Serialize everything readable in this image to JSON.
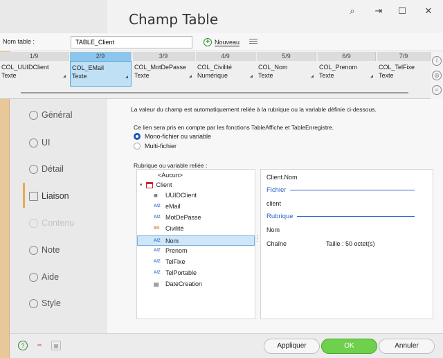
{
  "window": {
    "title": "Champ Table"
  },
  "titlebar_icons": [
    "search-icon",
    "pin-icon",
    "maximize-icon",
    "close-icon"
  ],
  "titlebar_glyphs": {
    "search": "⌕",
    "pin": "⇥",
    "maximize": "☐",
    "close": "✕"
  },
  "table_row": {
    "label": "Nom table :",
    "value": "TABLE_Client",
    "new_button": "Nouveau"
  },
  "columns": [
    {
      "num": "1/9",
      "name": "COL_UUIDClient",
      "type": "Texte"
    },
    {
      "num": "2/9",
      "name": "COL_EMail",
      "type": "Texte"
    },
    {
      "num": "3/9",
      "name": "COL_MotDePasse",
      "type": "Texte"
    },
    {
      "num": "4/9",
      "name": "COL_Civilité",
      "type": "Numérique"
    },
    {
      "num": "5/9",
      "name": "COL_Nom",
      "type": "Texte"
    },
    {
      "num": "6/9",
      "name": "COL_Prenom",
      "type": "Texte"
    },
    {
      "num": "7/9",
      "name": "COL_TelFixe",
      "type": "Texte"
    }
  ],
  "selected_column_index": 1,
  "nav": [
    {
      "label": "Général",
      "icon": "general-icon",
      "state": "normal"
    },
    {
      "label": "UI",
      "icon": "ui-icon",
      "state": "normal"
    },
    {
      "label": "Détail",
      "icon": "detail-icon",
      "state": "normal"
    },
    {
      "label": "Liaison",
      "icon": "liaison-icon",
      "state": "active"
    },
    {
      "label": "Contenu",
      "icon": "contenu-icon",
      "state": "disabled"
    },
    {
      "label": "Note",
      "icon": "note-icon",
      "state": "normal"
    },
    {
      "label": "Aide",
      "icon": "aide-icon",
      "state": "normal"
    },
    {
      "label": "Style",
      "icon": "style-icon",
      "state": "normal"
    }
  ],
  "main": {
    "line1": "La valeur du champ est automatiquement reliée à la rubrique ou la variable définie ci-dessous.",
    "line2": "Ce lien sera pris en compte par les fonctions TableAffiche et TableEnregistre.",
    "radio_mono": "Mono-fichier ou variable",
    "radio_multi": "Multi-fichier",
    "rubrique_label": "Rubrique ou variable reliée :"
  },
  "tree": {
    "none": "<Aucun>",
    "client": "Client",
    "items": [
      {
        "label": "UUIDClient",
        "badge": "",
        "icon": "uuid-icon"
      },
      {
        "label": "eMail",
        "badge": "A/Z",
        "icon": "text-field-icon"
      },
      {
        "label": "MotDePasse",
        "badge": "A/Z",
        "icon": "text-field-icon"
      },
      {
        "label": "Civilité",
        "badge": "8/9",
        "icon": "numeric-field-icon"
      },
      {
        "label": "Nom",
        "badge": "A/Z",
        "icon": "text-field-icon"
      },
      {
        "label": "Prenom",
        "badge": "A/Z",
        "icon": "text-field-icon"
      },
      {
        "label": "TelFixe",
        "badge": "A/Z",
        "icon": "text-field-icon"
      },
      {
        "label": "TelPortable",
        "badge": "A/Z",
        "icon": "text-field-icon"
      },
      {
        "label": "DateCreation",
        "badge": "",
        "icon": "date-field-icon"
      }
    ],
    "selected": "Nom"
  },
  "detail": {
    "path": "Client.Nom",
    "section_fichier": "Fichier",
    "fichier_value": "client",
    "section_rubrique": "Rubrique",
    "rubrique_value": "Nom",
    "type": "Chaîne",
    "size": "Taille : 50 octet(s)"
  },
  "bottom": {
    "apply": "Appliquer",
    "ok": "OK",
    "cancel": "Annuler"
  },
  "colors": {
    "ok_green": "#6fd04d",
    "accent_blue": "#2a62c9",
    "selected_col": "#bfe0f5",
    "nav_active_bar": "#e8a94f"
  }
}
